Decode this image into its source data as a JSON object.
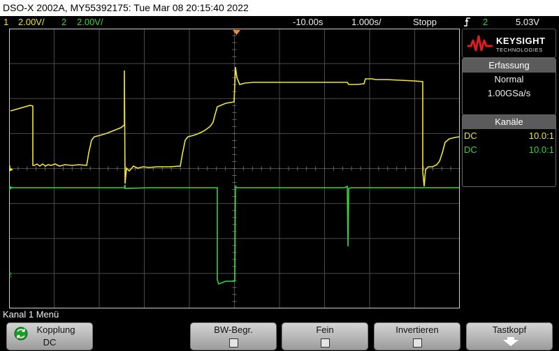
{
  "title": "DSO-X 2002A, MY55392175: Tue Mar 08 20:15:40 2022",
  "status": {
    "ch1_num": "1",
    "ch1_scale": "2.00V/",
    "ch2_num": "2",
    "ch2_scale": "2.00V/",
    "time_delay": "-10.00s",
    "time_scale": "1.000s/",
    "run_state": "Stopp",
    "trigger_icon": "trigger-edge-icon",
    "trigger_source": "2",
    "trigger_level": "5.03V"
  },
  "logo": {
    "brand": "KEYSIGHT",
    "sub": "TECHNOLOGIES"
  },
  "acquisition": {
    "title": "Erfassung",
    "mode": "Normal",
    "rate": "1.00GSa/s"
  },
  "channels": {
    "title": "Kanäle",
    "rows": [
      {
        "coupling": "DC",
        "probe": "10.0:1"
      },
      {
        "coupling": "DC",
        "probe": "10.0:1"
      }
    ]
  },
  "markers": {
    "ch1": "1",
    "ch2": "2"
  },
  "menu": {
    "title": "Kanal 1 Menü",
    "softkeys": {
      "kopplung": {
        "label": "Kopplung",
        "value": "DC"
      },
      "bw": {
        "label": "BW-Begr."
      },
      "fein": {
        "label": "Fein"
      },
      "invert": {
        "label": "Invertieren"
      },
      "tastkopf": {
        "label": "Tastkopf"
      }
    }
  },
  "colors": {
    "ch1": "#f2e53a",
    "ch2": "#34d63a",
    "trigger_marker": "#ff8c1a",
    "grid": "#4a4a4a"
  }
}
